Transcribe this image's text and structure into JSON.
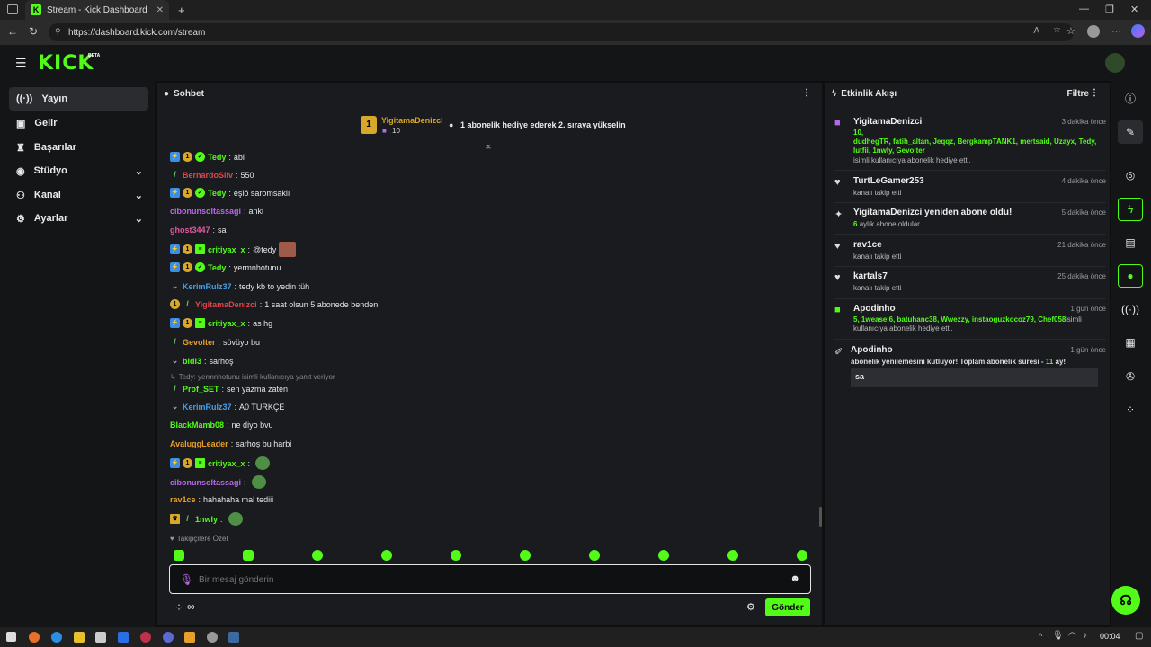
{
  "browser": {
    "tab_title": "Stream - Kick Dashboard",
    "url": "https://dashboard.kick.com/stream"
  },
  "app": {
    "logo": "KICK",
    "beta": "BETA"
  },
  "sidebar": {
    "items": [
      {
        "label": "Yayın",
        "icon": "broadcast-icon"
      },
      {
        "label": "Gelir",
        "icon": "money-icon"
      },
      {
        "label": "Başarılar",
        "icon": "trophy-icon"
      },
      {
        "label": "Stüdyo",
        "icon": "studio-icon"
      },
      {
        "label": "Kanal",
        "icon": "channel-icon"
      },
      {
        "label": "Ayarlar",
        "icon": "gear-icon"
      }
    ]
  },
  "chat": {
    "title": "Sohbet",
    "pinned": {
      "badge": "1",
      "user": "YigitamaDenizci",
      "gift_count": "10",
      "text": "1 abonelik hediye ederek 2. sıraya yükselin"
    },
    "messages": [
      {
        "user": "Tedy",
        "color": "#53fc18",
        "text": "abi"
      },
      {
        "user": "BernardoSilv",
        "color": "#e0464b",
        "text": "550"
      },
      {
        "user": "Tedy",
        "color": "#53fc18",
        "text": "eşiö saromsaklı"
      },
      {
        "user": "cibonunsoltassagi",
        "color": "#b868e8",
        "text": "anki"
      },
      {
        "user": "ghost3447",
        "color": "#e05aa0",
        "text": "sa"
      },
      {
        "user": "critiyax_x",
        "color": "#53fc18",
        "text": "@tedy"
      },
      {
        "user": "Tedy",
        "color": "#53fc18",
        "text": "yermnhotunu"
      },
      {
        "user": "KerimRulz37",
        "color": "#4a9ee8",
        "text": "tedy kb to yedin tüh"
      },
      {
        "user": "YigitamaDenizci",
        "color": "#e0464b",
        "text": "1 saat olsun 5 abonede benden"
      },
      {
        "user": "critiyax_x",
        "color": "#53fc18",
        "text": "as hg"
      },
      {
        "user": "Gevolter",
        "color": "#e8a02a",
        "text": "sövüyo bu"
      },
      {
        "user": "bidi3",
        "color": "#53fc18",
        "text": "sarhoş"
      },
      {
        "user": "Prof_SET",
        "color": "#53fc18",
        "text": "sen yazma zaten"
      },
      {
        "user": "KerimRulz37",
        "color": "#4a9ee8",
        "text": "A0 TÜRKÇE"
      },
      {
        "user": "BlackMamb08",
        "color": "#53fc18",
        "text": "ne diyo bvu"
      },
      {
        "user": "AvaluggLeader",
        "color": "#e8a02a",
        "text": "sarhoş bu harbi"
      },
      {
        "user": "critiyax_x",
        "color": "#53fc18",
        "text": ""
      },
      {
        "user": "cibonunsoltassagi",
        "color": "#b868e8",
        "text": ""
      },
      {
        "user": "rav1ce",
        "color": "#e8a02a",
        "text": "hahahaha mal tediii"
      },
      {
        "user": "1nwly",
        "color": "#53fc18",
        "text": ""
      }
    ],
    "reply_note": "Tedy: yermnhotunu isimli kullanıcıya yanıt veriyor",
    "followers_label": "Takipçilere Özel",
    "input_placeholder": "Bir mesaj gönderin",
    "send_label": "Gönder"
  },
  "activity": {
    "title": "Etkinlik Akışı",
    "filter": "Filtre",
    "events": [
      {
        "name": "YigitamaDenizci",
        "time": "3 dakika önce",
        "count": "10,",
        "names": "dudhegTR, fatih_altan, Jeqqz, BergkampTANK1, mertsaid, Uzayx, Tedy, lutfii, 1nwly, Gevolter",
        "sub": "isimli kullanıcıya abonelik hediye etti."
      },
      {
        "name": "TurtLeGamer253",
        "time": "4 dakika önce",
        "sub": "kanalı takip etti"
      },
      {
        "name": "YigitamaDenizci yeniden abone oldu!",
        "time": "5 dakika önce",
        "months": "6",
        "sub": "aylık abone oldular"
      },
      {
        "name": "rav1ce",
        "time": "21 dakika önce",
        "sub": "kanalı takip etti"
      },
      {
        "name": "kartals7",
        "time": "25 dakika önce",
        "sub": "kanalı takip etti"
      },
      {
        "name": "Apodinho",
        "time": "1 gün önce",
        "names": "5, 1weasel6, batuhanc38, Wwezzy, instaoguzkocoz79, Chef058",
        "sub2": "isimli",
        "sub": "kullanıcıya abonelik hediye etti."
      },
      {
        "name": "Apodinho",
        "time": "1 gün önce",
        "sub": "abonelik yenilemesini kutluyor! Toplam abonelik süresi -",
        "total": "11",
        "unit": "ay!",
        "message": "sa"
      }
    ]
  },
  "taskbar": {
    "time": "00:04"
  },
  "colors": {
    "accent": "#53fc18",
    "panel": "#191b1f",
    "background": "#0f0f10"
  }
}
